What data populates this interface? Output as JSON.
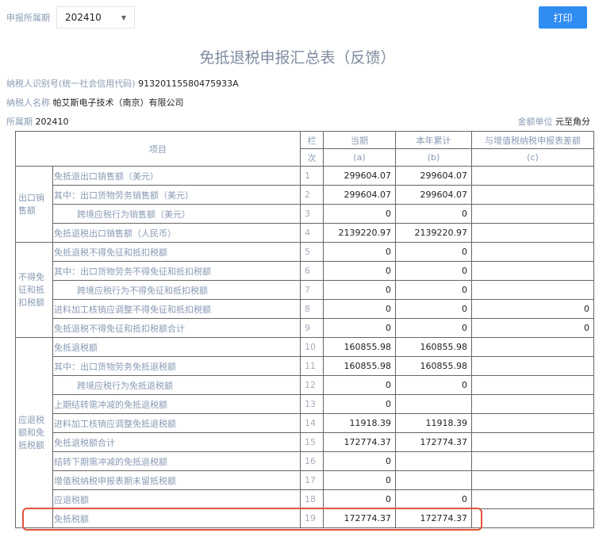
{
  "top": {
    "period_label": "申报所属期",
    "period_value": "202410",
    "print": "打印"
  },
  "title": "免抵退税申报汇总表（反馈）",
  "info": {
    "id_label": "纳税人识别号(统一社会信用代码)",
    "id_value": "91320115580475933A",
    "name_label": "纳税人名称",
    "name_value": "帕艾斯电子技术（南京）有限公司",
    "period_label": "所属期",
    "period_value": "202410",
    "unit_label": "金额单位",
    "unit_value": "元至角分"
  },
  "header": {
    "item": "项目",
    "lan1": "栏",
    "lan2": "次",
    "a": "当期",
    "b": "本年累计",
    "c": "与增值税纳税申报表差额",
    "a2": "(a)",
    "b2": "(b)",
    "c2": "(c)"
  },
  "categories": [
    "出口销售额",
    "不得免征和抵扣税额",
    "应退税额和免抵税额"
  ],
  "rows": [
    {
      "item": "免抵退出口销售额（美元）",
      "no": "1",
      "a": "299604.07",
      "b": "299604.07",
      "c": ""
    },
    {
      "item": "其中：出口货物劳务销售额（美元）",
      "no": "2",
      "a": "299604.07",
      "b": "299604.07",
      "c": ""
    },
    {
      "item": "跨境应税行为销售额（美元）",
      "no": "3",
      "a": "0",
      "b": "0",
      "c": ""
    },
    {
      "item": "免抵退税出口销售额（人民币）",
      "no": "4",
      "a": "2139220.97",
      "b": "2139220.97",
      "c": ""
    },
    {
      "item": "免抵退税不得免征和抵扣税额",
      "no": "5",
      "a": "0",
      "b": "0",
      "c": ""
    },
    {
      "item": "其中：出口货物劳务不得免征和抵扣税额",
      "no": "6",
      "a": "0",
      "b": "0",
      "c": ""
    },
    {
      "item": "跨境应税行为不得免征和抵扣税额",
      "no": "7",
      "a": "0",
      "b": "0",
      "c": ""
    },
    {
      "item": "进料加工核销应调整不得免征和抵扣税额",
      "no": "8",
      "a": "0",
      "b": "0",
      "c": "0"
    },
    {
      "item": "免抵退税不得免征和抵扣税额合计",
      "no": "9",
      "a": "0",
      "b": "0",
      "c": "0"
    },
    {
      "item": "免抵退税额",
      "no": "10",
      "a": "160855.98",
      "b": "160855.98",
      "c": ""
    },
    {
      "item": "其中：出口货物劳务免抵退税额",
      "no": "11",
      "a": "160855.98",
      "b": "160855.98",
      "c": ""
    },
    {
      "item": "跨境应税行为免抵退税额",
      "no": "12",
      "a": "0",
      "b": "0",
      "c": ""
    },
    {
      "item": "上期结转需冲减的免抵退税额",
      "no": "13",
      "a": "0",
      "b": "",
      "c": ""
    },
    {
      "item": "进料加工核销应调整免抵退税额",
      "no": "14",
      "a": "11918.39",
      "b": "11918.39",
      "c": ""
    },
    {
      "item": "免抵退税额合计",
      "no": "15",
      "a": "172774.37",
      "b": "172774.37",
      "c": ""
    },
    {
      "item": "结转下期需冲减的免抵退税额",
      "no": "16",
      "a": "0",
      "b": "",
      "c": ""
    },
    {
      "item": "增值税纳税申报表期末留抵税额",
      "no": "17",
      "a": "0",
      "b": "",
      "c": ""
    },
    {
      "item": "应退税额",
      "no": "18",
      "a": "0",
      "b": "0",
      "c": ""
    },
    {
      "item": "免抵税额",
      "no": "19",
      "a": "172774.37",
      "b": "172774.37",
      "c": ""
    }
  ]
}
